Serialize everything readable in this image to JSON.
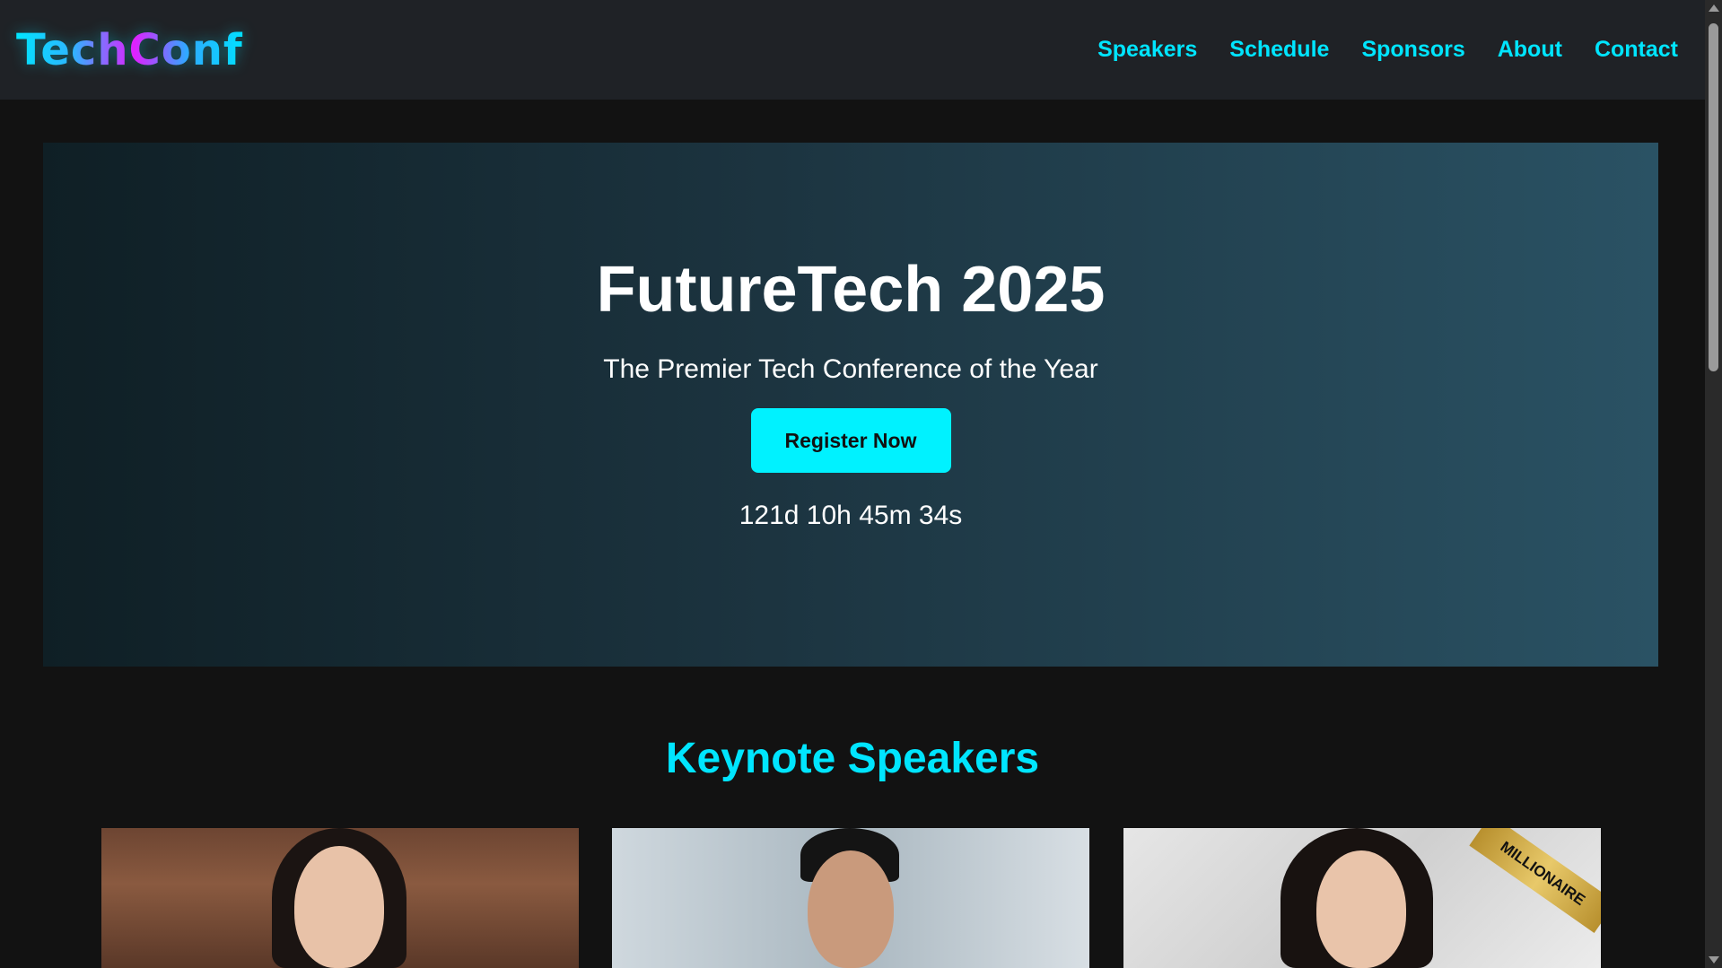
{
  "header": {
    "logo": "TechConf",
    "nav": [
      "Speakers",
      "Schedule",
      "Sponsors",
      "About",
      "Contact"
    ]
  },
  "hero": {
    "title": "FutureTech 2025",
    "subtitle": "The Premier Tech Conference of the Year",
    "register_label": "Register Now",
    "countdown": "121d 10h 45m 34s"
  },
  "speakers": {
    "title": "Keynote Speakers",
    "badge": "MILLIONAIRE"
  },
  "colors": {
    "accent": "#00e5ff",
    "background": "#121212",
    "navbar": "#1f2226"
  }
}
